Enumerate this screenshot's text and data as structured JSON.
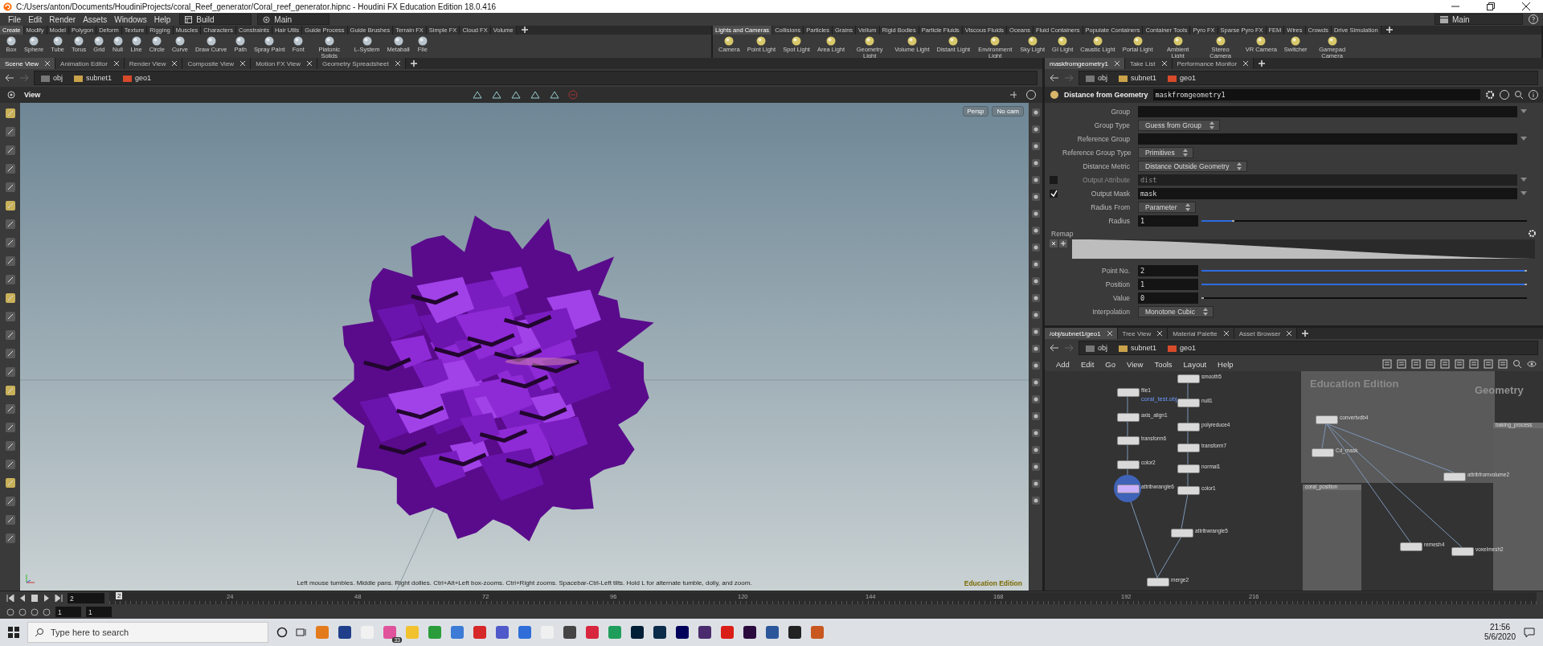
{
  "window": {
    "title": "C:/Users/anton/Documents/HoudiniProjects/coral_Reef_generator/Coral_reef_generator.hipnc - Houdini FX Education Edition 18.0.416"
  },
  "menu": [
    "File",
    "Edit",
    "Render",
    "Assets",
    "Windows",
    "Help"
  ],
  "desktop": "Build",
  "layout": "Main",
  "right_layout": "Main",
  "shelves": [
    {
      "tabs": [
        {
          "label": "Create",
          "selected": true
        },
        {
          "label": "Modify",
          "selected": false
        },
        {
          "label": "Model",
          "selected": false
        },
        {
          "label": "Polygon",
          "selected": false
        },
        {
          "label": "Deform",
          "selected": false
        },
        {
          "label": "Texture",
          "selected": false
        },
        {
          "label": "Rigging",
          "selected": false
        },
        {
          "label": "Muscles",
          "selected": false
        },
        {
          "label": "Characters",
          "selected": false
        },
        {
          "label": "Constraints",
          "selected": false
        },
        {
          "label": "Hair Utils",
          "selected": false
        },
        {
          "label": "Guide Process",
          "selected": false
        },
        {
          "label": "Guide Brushes",
          "selected": false
        },
        {
          "label": "Terrain FX",
          "selected": false
        },
        {
          "label": "Simple FX",
          "selected": false
        },
        {
          "label": "Cloud FX",
          "selected": false
        },
        {
          "label": "Volume",
          "selected": false
        }
      ],
      "tools": [
        "Box",
        "Sphere",
        "Tube",
        "Torus",
        "Grid",
        "Null",
        "Line",
        "Circle",
        "Curve",
        "Draw Curve",
        "Path",
        "Spray Paint",
        "Font",
        "Platonic Solids",
        "L-System",
        "Metaball",
        "File"
      ]
    },
    {
      "tabs": [
        {
          "label": "Lights and Cameras",
          "selected": true
        },
        {
          "label": "Collisions",
          "selected": false
        },
        {
          "label": "Particles",
          "selected": false
        },
        {
          "label": "Grains",
          "selected": false
        },
        {
          "label": "Vellum",
          "selected": false
        },
        {
          "label": "Rigid Bodies",
          "selected": false
        },
        {
          "label": "Particle Fluids",
          "selected": false
        },
        {
          "label": "Viscous Fluids",
          "selected": false
        },
        {
          "label": "Oceans",
          "selected": false
        },
        {
          "label": "Fluid Containers",
          "selected": false
        },
        {
          "label": "Populate Containers",
          "selected": false
        },
        {
          "label": "Container Tools",
          "selected": false
        },
        {
          "label": "Pyro FX",
          "selected": false
        },
        {
          "label": "Sparse Pyro FX",
          "selected": false
        },
        {
          "label": "FEM",
          "selected": false
        },
        {
          "label": "Wires",
          "selected": false
        },
        {
          "label": "Crowds",
          "selected": false
        },
        {
          "label": "Drive Simulation",
          "selected": false
        }
      ],
      "tools": [
        "Camera",
        "Point Light",
        "Spot Light",
        "Area Light",
        "Geometry Light",
        "Volume Light",
        "Distant Light",
        "Environment Light",
        "Sky Light",
        "GI Light",
        "Caustic Light",
        "Portal Light",
        "Ambient Light",
        "Stereo Camera",
        "VR Camera",
        "Switcher",
        "Gamepad Camera"
      ]
    }
  ],
  "scene_pane": {
    "tabs": [
      {
        "label": "Scene View",
        "selected": true
      },
      {
        "label": "Animation Editor",
        "selected": false
      },
      {
        "label": "Render View",
        "selected": false
      },
      {
        "label": "Composite View",
        "selected": false
      },
      {
        "label": "Motion FX View",
        "selected": false
      },
      {
        "label": "Geometry Spreadsheet",
        "selected": false
      }
    ],
    "path": [
      "obj",
      "subnet1",
      "geo1"
    ],
    "view_title": "View",
    "camera_buttons": [
      "Persp",
      "No cam"
    ],
    "status": "Left mouse tumbles. Middle pans. Right dollies. Ctrl+Alt+Left box-zooms. Ctrl+Right zooms. Spacebar-Ctrl-Left tilts. Hold L for alternate tumble, dolly, and zoom.",
    "edition": "Education Edition"
  },
  "parameters": {
    "tabs": [
      {
        "label": "maskfromgeometry1",
        "selected": true
      },
      {
        "label": "Take List",
        "selected": false
      },
      {
        "label": "Performance Monitor",
        "selected": false
      }
    ],
    "path": [
      "obj",
      "subnet1",
      "geo1"
    ],
    "node_type": "Distance from Geometry",
    "node_name": "maskfromgeometry1",
    "rows": [
      {
        "kind": "field",
        "label": "Group"
      },
      {
        "kind": "menu",
        "label": "Group Type",
        "value": "Guess from Group"
      },
      {
        "kind": "field",
        "label": "Reference Group"
      },
      {
        "kind": "menu",
        "label": "Reference Group Type",
        "value": "Primitives"
      },
      {
        "kind": "menu",
        "label": "Distance Metric",
        "value": "Distance Outside Geometry"
      },
      {
        "kind": "toggle",
        "label": "Output Attribute",
        "value": "dist",
        "checked": false
      },
      {
        "kind": "toggle",
        "label": "Output Mask",
        "value": "mask",
        "checked": true
      },
      {
        "kind": "menu",
        "label": "Radius From",
        "value": "Parameter"
      },
      {
        "kind": "slider",
        "label": "Radius",
        "value": "1",
        "level": 0.1
      }
    ],
    "remap": {
      "label": "Remap",
      "rows": [
        {
          "kind": "slider",
          "label": "Point No.",
          "value": "2",
          "level": 1
        },
        {
          "kind": "slider",
          "label": "Position",
          "value": "1",
          "level": 1
        },
        {
          "kind": "slider",
          "label": "Value",
          "value": "0",
          "level": 0
        },
        {
          "kind": "menu",
          "label": "Interpolation",
          "value": "Monotone Cubic"
        }
      ]
    }
  },
  "network": {
    "tabs": [
      {
        "label": "/obj/subnet1/geo1",
        "selected": true
      },
      {
        "label": "Tree View",
        "selected": false
      },
      {
        "label": "Material Palette",
        "selected": false
      },
      {
        "label": "Asset Browser",
        "selected": false
      }
    ],
    "path": [
      "obj",
      "subnet1",
      "geo1"
    ],
    "menu": [
      "Add",
      "Edit",
      "Go",
      "View",
      "Tools",
      "Layout",
      "Help"
    ],
    "watermarks": [
      "Education Edition",
      "Geometry"
    ],
    "boxes": [
      "coral_position",
      "baking_process"
    ],
    "nodes": [
      {
        "name": "file1",
        "note": "coral_test.obj",
        "selected": false
      },
      {
        "name": "axis_align1",
        "selected": false
      },
      {
        "name": "transform6",
        "selected": false
      },
      {
        "name": "color2",
        "selected": false
      },
      {
        "name": "attribwrangle6",
        "selected": true
      },
      {
        "name": "smooth5",
        "selected": false
      },
      {
        "name": "null1",
        "selected": false
      },
      {
        "name": "polyreduce4",
        "selected": false
      },
      {
        "name": "transform7",
        "selected": false
      },
      {
        "name": "normal1",
        "selected": false
      },
      {
        "name": "color1",
        "selected": false
      },
      {
        "name": "attribwrangle5",
        "selected": false
      },
      {
        "name": "merge2",
        "selected": false
      },
      {
        "name": "convertvdb4",
        "selected": false
      },
      {
        "name": "Cd_mask",
        "selected": false
      },
      {
        "name": "attribfromvolume2",
        "selected": false
      },
      {
        "name": "remesh4",
        "selected": false
      },
      {
        "name": "voxelmesh2",
        "selected": false
      }
    ]
  },
  "timeline": {
    "frame": "2",
    "marker": "2",
    "ticks": [
      "24",
      "48",
      "72",
      "96",
      "120",
      "144",
      "168",
      "192",
      "216"
    ],
    "start": "1",
    "range_start": "1"
  },
  "taskbar": {
    "search_placeholder": "Type here to search",
    "badge": "33",
    "time": "21:56",
    "date": "5/6/2020"
  }
}
